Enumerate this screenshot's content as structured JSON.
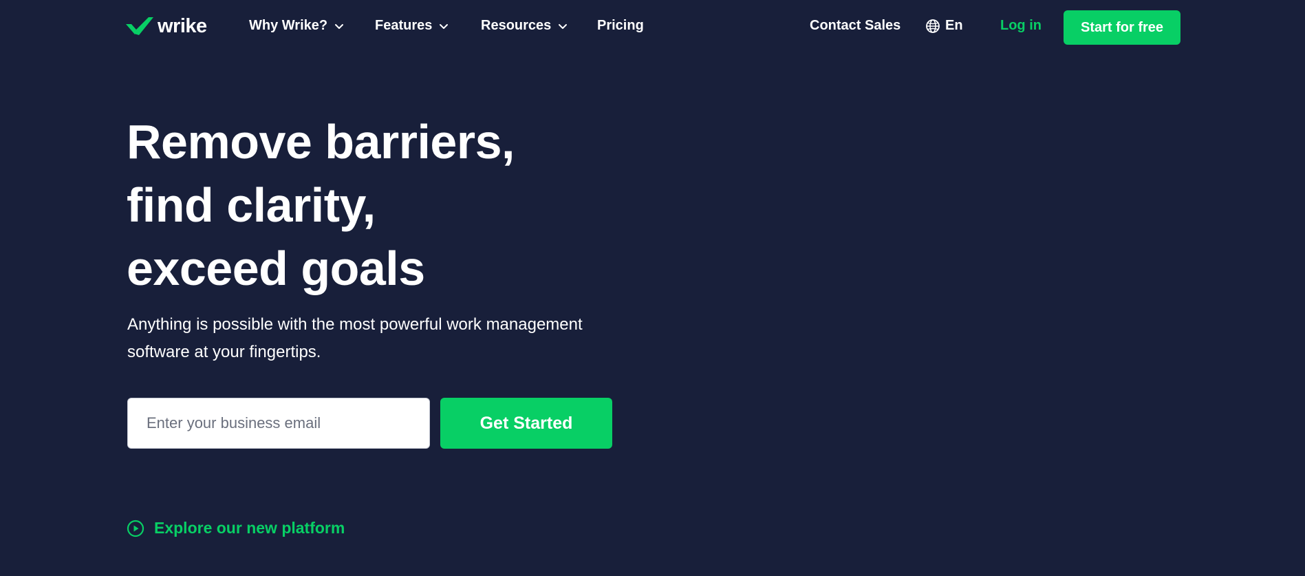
{
  "brand": {
    "name": "wrike",
    "accent_color": "#08cf65",
    "background_color": "#181f3a",
    "logo_icon": "checkmark-icon"
  },
  "nav": {
    "items": [
      {
        "label": "Why Wrike?",
        "has_dropdown": true
      },
      {
        "label": "Features",
        "has_dropdown": true
      },
      {
        "label": "Resources",
        "has_dropdown": true
      },
      {
        "label": "Pricing",
        "has_dropdown": false
      }
    ],
    "contact_sales": "Contact Sales",
    "language": {
      "icon": "globe-icon",
      "label": "En"
    },
    "login": "Log in",
    "start_free": "Start for free"
  },
  "hero": {
    "title_lines": [
      "Remove barriers,",
      "find clarity,",
      "exceed goals"
    ],
    "subtitle": "Anything is possible with the most powerful work management software at your fingertips.",
    "email_placeholder": "Enter your business email",
    "email_value": "",
    "cta": "Get Started",
    "explore": {
      "icon": "play-circle-icon",
      "label": "Explore our new platform"
    }
  }
}
